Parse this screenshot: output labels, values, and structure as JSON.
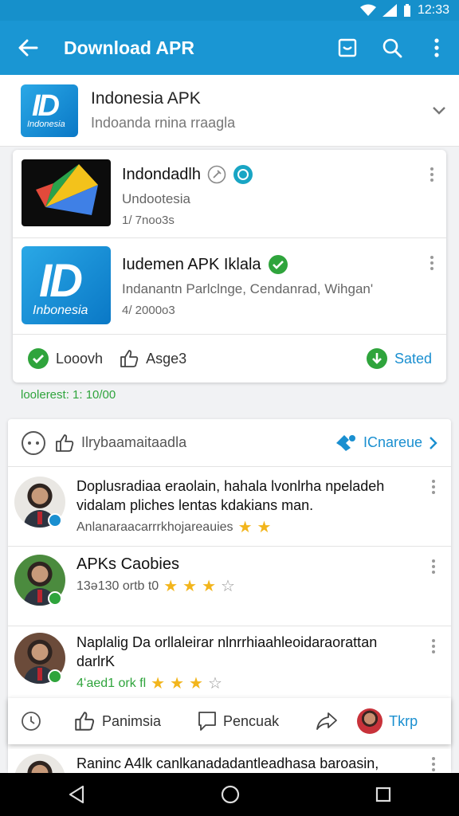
{
  "status_bar": {
    "time": "12:33"
  },
  "app_bar": {
    "title": "Download APR"
  },
  "header": {
    "tile_big": "ID",
    "tile_small": "Indonesia",
    "title": "Indonesia APK",
    "subtitle": "Indoanda rnina rraagla"
  },
  "card1": {
    "items": [
      {
        "name": "Indondadlh",
        "sub": "Undootesia",
        "date": "1/ 7noo3s"
      },
      {
        "name": "Iudemen APK Iklala",
        "sub": "Indanantn Parlclnge, Cendanrad, Wihgan'",
        "date": "4/ 2000o3",
        "tile_big": "ID",
        "tile_small": "Inbonesia"
      }
    ],
    "actions": {
      "like": "Looovh",
      "share": "Asge3",
      "saved": "Sated"
    }
  },
  "interest_text": "loolerest: 1: 10/00",
  "card2": {
    "header_label": "Ilrybaamaitaadla",
    "more_label": "ICnareue",
    "reviews": [
      {
        "line1": "Doplusradiaa eraolain, hahala lvonlrha npeladeh",
        "line2": "vidalam pliches lentas kdakians man.",
        "meta": "Anlanaraacarrrkhojareauies"
      },
      {
        "line1": "APKs Caobies",
        "meta": "13ə130 ortb  t0"
      },
      {
        "line1": "Naplalig Da orllaleirar nlnrrhiaahleoidaraorattan",
        "line2": "darlrK",
        "meta": "4ʻaed1 ork  fl"
      }
    ],
    "peek_text": "Raninc A4lk canlkanadadantleadhasa baroasin,"
  },
  "float_bar": {
    "like": "Panimsia",
    "comment": "Pencuak",
    "user": "Tkrp"
  },
  "colors": {
    "primary": "#1a96d3",
    "accent_green": "#2fa43c",
    "star": "#f2b51c"
  }
}
